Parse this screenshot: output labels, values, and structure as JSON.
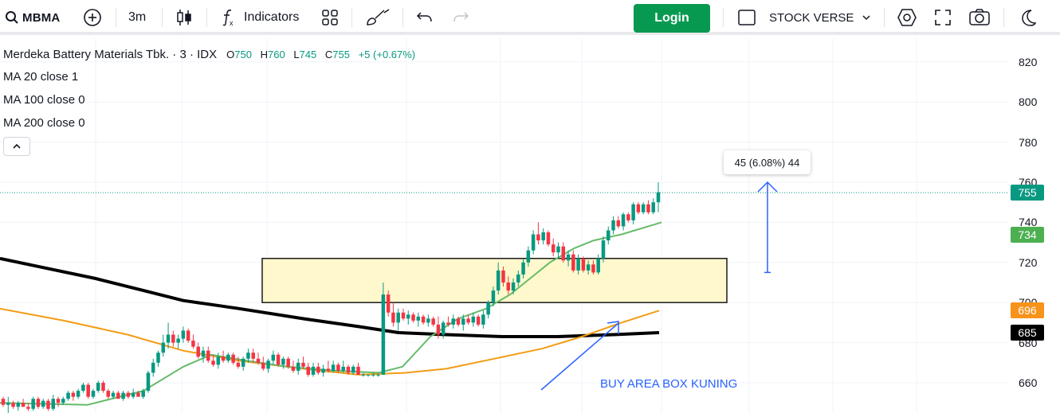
{
  "toolbar": {
    "symbol": "MBMA",
    "interval": "3m",
    "indicators_label": "Indicators",
    "login_label": "Login",
    "layout_name": "STOCK VERSE"
  },
  "legend": {
    "title": "Merdeka Battery Materials Tbk. · 3 · IDX",
    "open_key": "O",
    "open": "750",
    "high_key": "H",
    "high": "760",
    "low_key": "L",
    "low": "745",
    "close_key": "C",
    "close": "755",
    "change": "+5 (+0.67%)",
    "ma": [
      "MA 20 close 1",
      "MA 100 close 0",
      "MA 200 close 0"
    ]
  },
  "price_axis": {
    "ticks": [
      "820",
      "800",
      "780",
      "760",
      "740",
      "720",
      "700",
      "680",
      "660"
    ],
    "tags": [
      {
        "label": "755",
        "color": "#089981",
        "text_color": "#ffffff",
        "value": 755
      },
      {
        "label": "734",
        "color": "#4caf50",
        "text_color": "#ffffff",
        "value": 734
      },
      {
        "label": "696",
        "color": "#f7931a",
        "text_color": "#ffffff",
        "value": 696
      },
      {
        "label": "685",
        "color": "#000000",
        "text_color": "#ffffff",
        "value": 685
      }
    ]
  },
  "annotations": {
    "measure_label": "45 (6.08%) 44",
    "buy_label": "BUY AREA BOX KUNING"
  },
  "colors": {
    "up": "#089981",
    "down": "#f23645",
    "ma20": "#66bb6a",
    "ma100": "#f39c12",
    "ma200": "#000000",
    "box_fill": "#fff8cc",
    "arrow": "#2962ff",
    "login": "#089950"
  },
  "chart_data": {
    "type": "candlestick",
    "y_range": [
      652,
      828
    ],
    "last_price": 755,
    "box": {
      "low": 700,
      "high": 722
    },
    "measure": {
      "from": 715,
      "to": 760
    },
    "candles": [
      [
        652,
        653,
        648,
        649
      ],
      [
        649,
        653,
        645,
        650
      ],
      [
        650,
        651,
        647,
        648
      ],
      [
        648,
        651,
        646,
        650
      ],
      [
        650,
        652,
        648,
        648
      ],
      [
        648,
        650,
        646,
        647
      ],
      [
        647,
        653,
        646,
        652
      ],
      [
        652,
        653,
        647,
        648
      ],
      [
        648,
        652,
        647,
        651
      ],
      [
        651,
        652,
        646,
        647
      ],
      [
        647,
        654,
        646,
        652
      ],
      [
        652,
        653,
        648,
        650
      ],
      [
        650,
        653,
        649,
        652
      ],
      [
        652,
        656,
        651,
        655
      ],
      [
        655,
        656,
        651,
        653
      ],
      [
        653,
        657,
        652,
        656
      ],
      [
        656,
        660,
        655,
        659
      ],
      [
        659,
        660,
        652,
        653
      ],
      [
        653,
        657,
        652,
        656
      ],
      [
        656,
        661,
        655,
        660
      ],
      [
        660,
        661,
        655,
        656
      ],
      [
        656,
        657,
        652,
        653
      ],
      [
        653,
        656,
        652,
        655
      ],
      [
        655,
        656,
        652,
        652
      ],
      [
        652,
        656,
        651,
        655
      ],
      [
        655,
        656,
        652,
        653
      ],
      [
        653,
        657,
        652,
        655
      ],
      [
        655,
        656,
        653,
        653
      ],
      [
        653,
        657,
        652,
        656
      ],
      [
        656,
        666,
        655,
        665
      ],
      [
        665,
        672,
        663,
        670
      ],
      [
        670,
        676,
        668,
        675
      ],
      [
        675,
        684,
        673,
        680
      ],
      [
        680,
        690,
        677,
        684
      ],
      [
        684,
        686,
        678,
        680
      ],
      [
        680,
        684,
        677,
        682
      ],
      [
        682,
        688,
        680,
        686
      ],
      [
        686,
        687,
        680,
        681
      ],
      [
        681,
        684,
        677,
        678
      ],
      [
        678,
        680,
        672,
        673
      ],
      [
        673,
        678,
        670,
        676
      ],
      [
        676,
        678,
        670,
        671
      ],
      [
        671,
        674,
        668,
        669
      ],
      [
        669,
        675,
        667,
        673
      ],
      [
        673,
        676,
        670,
        671
      ],
      [
        671,
        675,
        670,
        674
      ],
      [
        674,
        675,
        669,
        670
      ],
      [
        670,
        673,
        667,
        668
      ],
      [
        668,
        673,
        666,
        672
      ],
      [
        672,
        677,
        670,
        675
      ],
      [
        675,
        677,
        670,
        672
      ],
      [
        672,
        675,
        669,
        670
      ],
      [
        670,
        673,
        666,
        667
      ],
      [
        667,
        672,
        665,
        671
      ],
      [
        671,
        676,
        669,
        674
      ],
      [
        674,
        675,
        668,
        669
      ],
      [
        669,
        673,
        667,
        672
      ],
      [
        672,
        673,
        667,
        668
      ],
      [
        668,
        671,
        665,
        666
      ],
      [
        666,
        672,
        664,
        670
      ],
      [
        670,
        673,
        667,
        668
      ],
      [
        668,
        670,
        663,
        664
      ],
      [
        664,
        670,
        663,
        668
      ],
      [
        668,
        670,
        664,
        665
      ],
      [
        665,
        669,
        663,
        667
      ],
      [
        667,
        671,
        665,
        666
      ],
      [
        666,
        671,
        665,
        669
      ],
      [
        669,
        670,
        665,
        666
      ],
      [
        666,
        671,
        665,
        668
      ],
      [
        668,
        669,
        664,
        665
      ],
      [
        665,
        669,
        664,
        668
      ],
      [
        668,
        670,
        664,
        664
      ],
      [
        664,
        665,
        663,
        664
      ],
      [
        664,
        664,
        663,
        664
      ],
      [
        664,
        665,
        663,
        664
      ],
      [
        664,
        665,
        663,
        664
      ],
      [
        664,
        710,
        664,
        704
      ],
      [
        704,
        706,
        693,
        695
      ],
      [
        695,
        700,
        688,
        690
      ],
      [
        690,
        697,
        686,
        695
      ],
      [
        695,
        697,
        691,
        692
      ],
      [
        692,
        696,
        689,
        694
      ],
      [
        694,
        695,
        690,
        691
      ],
      [
        691,
        695,
        688,
        693
      ],
      [
        693,
        694,
        689,
        690
      ],
      [
        690,
        694,
        688,
        692
      ],
      [
        692,
        693,
        688,
        689
      ],
      [
        689,
        693,
        682,
        684
      ],
      [
        684,
        691,
        682,
        690
      ],
      [
        690,
        693,
        688,
        689
      ],
      [
        689,
        694,
        687,
        692
      ],
      [
        692,
        693,
        688,
        689
      ],
      [
        689,
        694,
        686,
        692
      ],
      [
        692,
        694,
        689,
        690
      ],
      [
        690,
        695,
        688,
        693
      ],
      [
        693,
        694,
        688,
        689
      ],
      [
        689,
        696,
        687,
        694
      ],
      [
        694,
        701,
        692,
        700
      ],
      [
        700,
        708,
        698,
        706
      ],
      [
        706,
        720,
        704,
        716
      ],
      [
        716,
        718,
        708,
        710
      ],
      [
        710,
        713,
        704,
        706
      ],
      [
        706,
        712,
        704,
        710
      ],
      [
        710,
        716,
        708,
        714
      ],
      [
        714,
        722,
        712,
        720
      ],
      [
        720,
        728,
        718,
        726
      ],
      [
        726,
        736,
        724,
        734
      ],
      [
        734,
        740,
        729,
        731
      ],
      [
        731,
        737,
        729,
        735
      ],
      [
        735,
        736,
        728,
        729
      ],
      [
        729,
        732,
        723,
        725
      ],
      [
        725,
        730,
        722,
        728
      ],
      [
        728,
        730,
        720,
        721
      ],
      [
        721,
        726,
        718,
        724
      ],
      [
        724,
        726,
        715,
        716
      ],
      [
        716,
        724,
        714,
        722
      ],
      [
        722,
        723,
        715,
        716
      ],
      [
        716,
        721,
        714,
        719
      ],
      [
        719,
        721,
        714,
        715
      ],
      [
        715,
        724,
        714,
        722
      ],
      [
        722,
        733,
        720,
        731
      ],
      [
        731,
        738,
        729,
        736
      ],
      [
        736,
        743,
        734,
        741
      ],
      [
        741,
        743,
        737,
        738
      ],
      [
        738,
        745,
        736,
        744
      ],
      [
        744,
        745,
        740,
        741
      ],
      [
        741,
        750,
        739,
        749
      ],
      [
        749,
        750,
        744,
        745
      ],
      [
        745,
        750,
        744,
        749
      ],
      [
        749,
        751,
        744,
        745
      ],
      [
        745,
        752,
        744,
        750
      ],
      [
        750,
        760,
        745,
        755
      ]
    ],
    "ma20": [
      [
        0,
        650
      ],
      [
        110,
        649
      ],
      [
        180,
        656
      ],
      [
        230,
        668
      ],
      [
        265,
        674
      ],
      [
        310,
        671
      ],
      [
        360,
        668
      ],
      [
        420,
        666
      ],
      [
        475,
        665
      ],
      [
        505,
        668
      ],
      [
        540,
        683
      ],
      [
        575,
        692
      ],
      [
        610,
        697
      ],
      [
        640,
        704
      ],
      [
        665,
        712
      ],
      [
        690,
        720
      ],
      [
        720,
        727
      ],
      [
        745,
        731
      ],
      [
        780,
        734
      ],
      [
        830,
        740
      ]
    ],
    "ma100": [
      [
        0,
        697
      ],
      [
        80,
        691
      ],
      [
        160,
        684
      ],
      [
        230,
        676
      ],
      [
        300,
        671
      ],
      [
        380,
        667
      ],
      [
        450,
        664
      ],
      [
        510,
        665
      ],
      [
        560,
        667
      ],
      [
        620,
        672
      ],
      [
        680,
        677
      ],
      [
        730,
        683
      ],
      [
        780,
        690
      ],
      [
        827,
        696
      ]
    ],
    "ma200": [
      [
        0,
        722
      ],
      [
        60,
        717
      ],
      [
        120,
        712
      ],
      [
        180,
        706
      ],
      [
        230,
        701
      ],
      [
        300,
        697
      ],
      [
        380,
        692
      ],
      [
        450,
        688
      ],
      [
        500,
        685
      ],
      [
        560,
        684
      ],
      [
        630,
        683
      ],
      [
        700,
        683
      ],
      [
        770,
        684
      ],
      [
        827,
        685
      ]
    ]
  }
}
